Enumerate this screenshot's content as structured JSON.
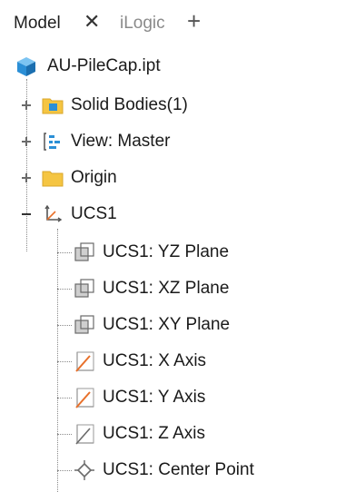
{
  "tabs": {
    "model_label": "Model",
    "close_glyph": "✕",
    "ilogic_label": "iLogic",
    "add_glyph": "+"
  },
  "tree": {
    "root": {
      "label": "AU-PileCap.ipt",
      "icon": "part-cube-icon"
    },
    "nodes": [
      {
        "label": "Solid Bodies(1)",
        "icon": "solid-bodies-folder-icon",
        "expander": "+"
      },
      {
        "label": "View: Master",
        "icon": "view-rep-icon",
        "expander": "+"
      },
      {
        "label": "Origin",
        "icon": "folder-icon",
        "expander": "+"
      },
      {
        "label": "UCS1",
        "icon": "ucs-axes-icon",
        "expander": "−"
      }
    ],
    "ucs_children": [
      {
        "label": "UCS1: YZ Plane",
        "icon": "work-plane-icon"
      },
      {
        "label": "UCS1: XZ Plane",
        "icon": "work-plane-icon"
      },
      {
        "label": "UCS1: XY Plane",
        "icon": "work-plane-icon"
      },
      {
        "label": "UCS1: X Axis",
        "icon": "work-axis-icon"
      },
      {
        "label": "UCS1: Y Axis",
        "icon": "work-axis-icon"
      },
      {
        "label": "UCS1: Z Axis",
        "icon": "work-axis-icon"
      },
      {
        "label": "UCS1: Center Point",
        "icon": "work-point-icon"
      }
    ]
  },
  "colors": {
    "cube_blue": "#2b8fd6",
    "folder_yellow": "#f5c542",
    "axis_orange": "#e8702a",
    "plane_gray": "#9a9a9a"
  }
}
